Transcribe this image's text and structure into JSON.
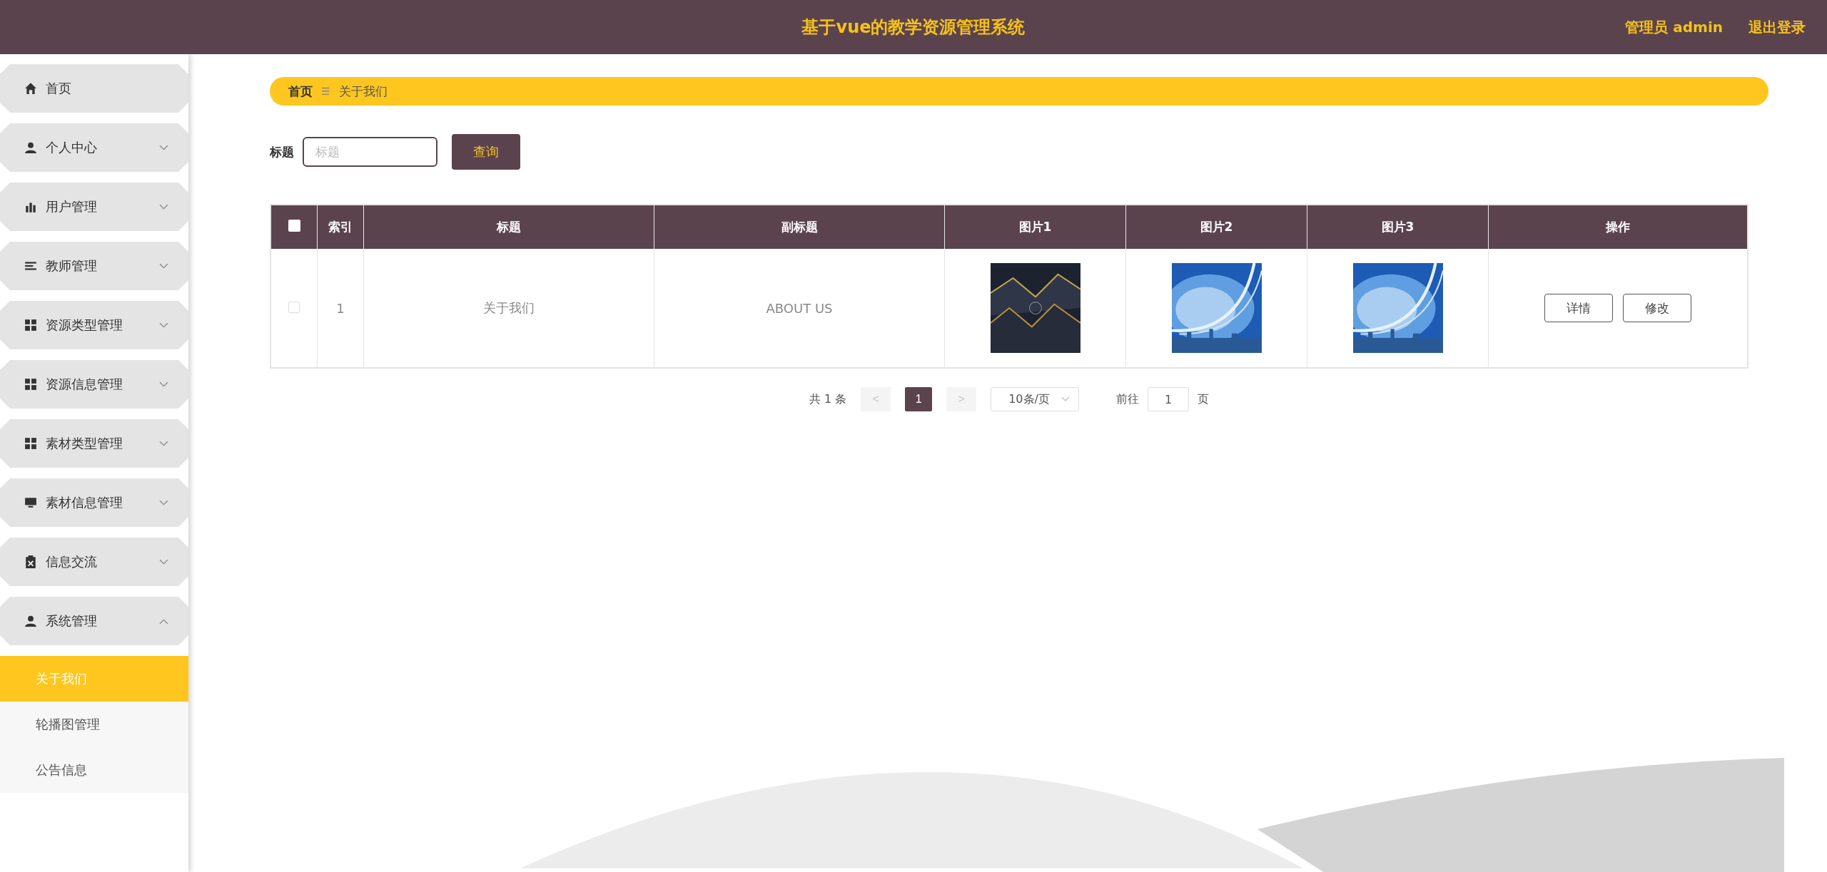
{
  "header": {
    "title": "基于vue的教学资源管理系统",
    "user": "管理员 admin",
    "logout": "退出登录"
  },
  "sidebar": {
    "items": [
      {
        "label": "首页",
        "kind": "home"
      },
      {
        "label": "个人中心",
        "kind": "user",
        "expanded": false
      },
      {
        "label": "用户管理",
        "kind": "chart",
        "expanded": false
      },
      {
        "label": "教师管理",
        "kind": "list",
        "expanded": false
      },
      {
        "label": "资源类型管理",
        "kind": "grid",
        "expanded": false
      },
      {
        "label": "资源信息管理",
        "kind": "grid",
        "expanded": false
      },
      {
        "label": "素材类型管理",
        "kind": "grid",
        "expanded": false
      },
      {
        "label": "素材信息管理",
        "kind": "monitor",
        "expanded": false
      },
      {
        "label": "信息交流",
        "kind": "clipboard",
        "expanded": false
      },
      {
        "label": "系统管理",
        "kind": "user",
        "expanded": true,
        "children": [
          {
            "label": "关于我们",
            "selected": true
          },
          {
            "label": "轮播图管理",
            "selected": false
          },
          {
            "label": "公告信息",
            "selected": false
          }
        ]
      }
    ]
  },
  "breadcrumb": [
    "首页",
    "关于我们"
  ],
  "breadcrumb_separator": "☰",
  "search": {
    "label": "标题",
    "placeholder": "标题",
    "button": "查询"
  },
  "table": {
    "columns": [
      "索引",
      "标题",
      "副标题",
      "图片1",
      "图片2",
      "图片3",
      "操作"
    ],
    "rows": [
      {
        "checked": false,
        "index": "1",
        "title": "关于我们",
        "subtitle": "ABOUT US",
        "images": [
          {
            "kind": "picture"
          },
          {
            "kind": "picture"
          },
          {
            "kind": "picture"
          }
        ],
        "actions": [
          "详情",
          "修改"
        ]
      }
    ],
    "header_checked": false
  },
  "pagination": {
    "total": "共 1 条",
    "prev": "<",
    "pages": [
      {
        "label": "1",
        "selected": true
      }
    ],
    "next": ">",
    "page_size": "10条/页",
    "goto_label": "前往",
    "goto_value": "1",
    "goto_suffix": "页"
  }
}
